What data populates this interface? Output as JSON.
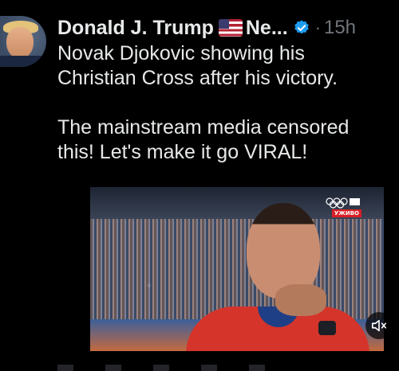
{
  "tweet": {
    "author": {
      "name": "Donald J. Trump",
      "name_truncated": "Ne...",
      "flag": "us-flag-icon",
      "verified_badge": "verified-icon",
      "avatar": "avatar"
    },
    "separator": "·",
    "timestamp": "15h",
    "paragraphs": [
      "Novak Djokovic showing his Christian Cross after his victory.",
      "The mainstream media censored this! Let's make it go VIRAL!"
    ],
    "media": {
      "type": "video",
      "live_badge": "УЖИВО",
      "mute_icon": "speaker-muted-icon"
    }
  },
  "colors": {
    "background": "#000000",
    "text": "#e7e9ea",
    "secondary_text": "#71767b",
    "verified_blue": "#1d9bf0",
    "live_red": "#d81f26"
  }
}
